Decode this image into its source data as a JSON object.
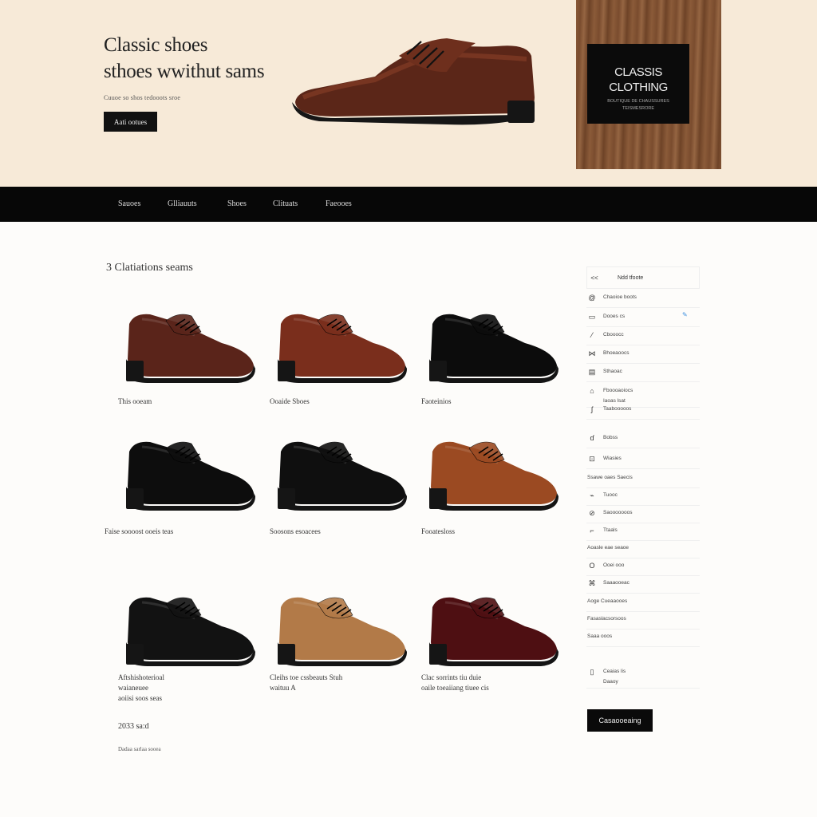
{
  "hero": {
    "title_line1": "Classic shoes",
    "title_line2": "sthoes wwithut sams",
    "subtitle": "Cuuoe so shos tedooots sroe",
    "button_label": "Aati ootues",
    "wood_card": {
      "brand_line1": "CLASSIS",
      "brand_line2": "CLOTHING",
      "tagline_line1": "BOUTIQUE DE CHAUSSURES",
      "tagline_line2": "TEISMESRORE"
    }
  },
  "nav": {
    "items": [
      "Sauoes",
      "Glliauuts",
      "Shoes",
      "Clituats",
      "Faeooes"
    ]
  },
  "products_section": {
    "title": "3 Clatiations seams"
  },
  "products": [
    {
      "label_lines": [
        "This ooeam"
      ],
      "color": "#5a241a"
    },
    {
      "label_lines": [
        "Ooaide Sboes"
      ],
      "color": "#7a2e1c"
    },
    {
      "label_lines": [
        "Faoteinios"
      ],
      "color": "#0c0c0c"
    },
    {
      "label_lines": [
        "Faise soooost ooeis teas"
      ],
      "color": "#0d0d0d"
    },
    {
      "label_lines": [
        "Soosons esoacees"
      ],
      "color": "#0f0f0f"
    },
    {
      "label_lines": [
        "Fooatesloss"
      ],
      "color": "#9b4a22"
    },
    {
      "label_lines": [
        "Aftshishoterioal",
        "waianeuee",
        "aoiisi soos seas"
      ],
      "color": "#121212"
    },
    {
      "label_lines": [
        "Cleihs toe cssbeauts Stuh",
        "waituu A"
      ],
      "color": "#b27a48"
    },
    {
      "label_lines": [
        "Clac sorrints tiu duie",
        "oaile toeaiiang tiuee cis"
      ],
      "color": "#4e0f12"
    }
  ],
  "price": {
    "value": "2033 sa:d",
    "note": "Dadaa sarlaa sooea"
  },
  "sidebar": {
    "header": {
      "arrow": "<<",
      "label": "Ndd tfoote"
    },
    "items": [
      {
        "icon": "@",
        "label": "Chaoioe boots",
        "icon_name": "globe-icon"
      },
      {
        "icon": "▭",
        "label": "Dooes cs",
        "icon_name": "card-icon"
      },
      {
        "icon": "⁄",
        "label": "Cbooocc",
        "icon_name": "tag-icon"
      },
      {
        "icon": "⋈",
        "label": "Bhoeaoocs",
        "icon_name": "grid-icon"
      },
      {
        "icon": "▤",
        "label": "Sthaoac",
        "icon_name": "list-icon"
      },
      {
        "icon": "⌂",
        "label": "Fboooaoiocs",
        "label2": "Iaoas lsat",
        "icon_name": "box-icon"
      },
      {
        "icon": "ʃ",
        "label": "Taabooooos",
        "icon_name": "hook-icon"
      },
      {
        "icon": "ɗ",
        "label": "Bobss",
        "icon_name": "link-icon"
      },
      {
        "icon": "⊡",
        "label": "Wiasies",
        "icon_name": "frame-icon"
      },
      {
        "icon": "",
        "label": "Ssawe oaes Saecis",
        "icon_name": ""
      },
      {
        "icon": "⌁",
        "label": "Tuooc",
        "icon_name": "wave-icon"
      },
      {
        "icon": "⊘",
        "label": "Saooooooos",
        "icon_name": "pattern-icon"
      },
      {
        "icon": "⌐",
        "label": "Ttaals",
        "icon_name": "corner-icon"
      },
      {
        "icon": "",
        "label": "Aoasle eae seaoe",
        "icon_name": ""
      },
      {
        "icon": "O",
        "label": "Ooei ooo",
        "icon_name": "circle-icon"
      },
      {
        "icon": "⌘",
        "label": "Saaaooeac",
        "icon_name": "command-icon"
      },
      {
        "icon": "",
        "label": "Aoge Cueaaooes",
        "icon_name": ""
      },
      {
        "icon": "",
        "label": "Fasaslacsorsoos",
        "icon_name": ""
      },
      {
        "icon": "",
        "label": "Saaa ooos",
        "icon_name": ""
      },
      {
        "icon": "▯",
        "label": "Ceaias lis",
        "label2": "Daaoy",
        "icon_name": "phone-icon"
      }
    ],
    "button_label": "Casaooeaing"
  },
  "colors": {
    "hero_bg": "#f7ead8",
    "nav_bg": "#070707",
    "accent_edit": "#3a8ee0"
  }
}
